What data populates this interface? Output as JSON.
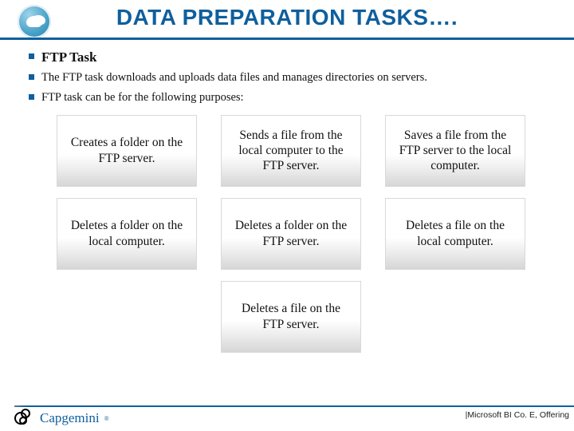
{
  "title": "DATA PREPARATION TASKS….",
  "section_heading": "FTP Task",
  "bullets": [
    "The FTP task downloads and uploads data files and manages directories on servers.",
    "FTP task can be for the following purposes:"
  ],
  "cards": {
    "row1": [
      "Creates a folder on the FTP server.",
      "Sends a file from the local computer to the FTP server.",
      "Saves a file from the FTP server to the local computer."
    ],
    "row2": [
      "Deletes a folder on the local computer.",
      "Deletes a folder on the FTP server.",
      "Deletes a file on the local computer."
    ],
    "row3": [
      "Deletes a file on the FTP server."
    ]
  },
  "footer": {
    "brand": "Capgemini",
    "right": "|Microsoft BI Co. E, Offering"
  }
}
